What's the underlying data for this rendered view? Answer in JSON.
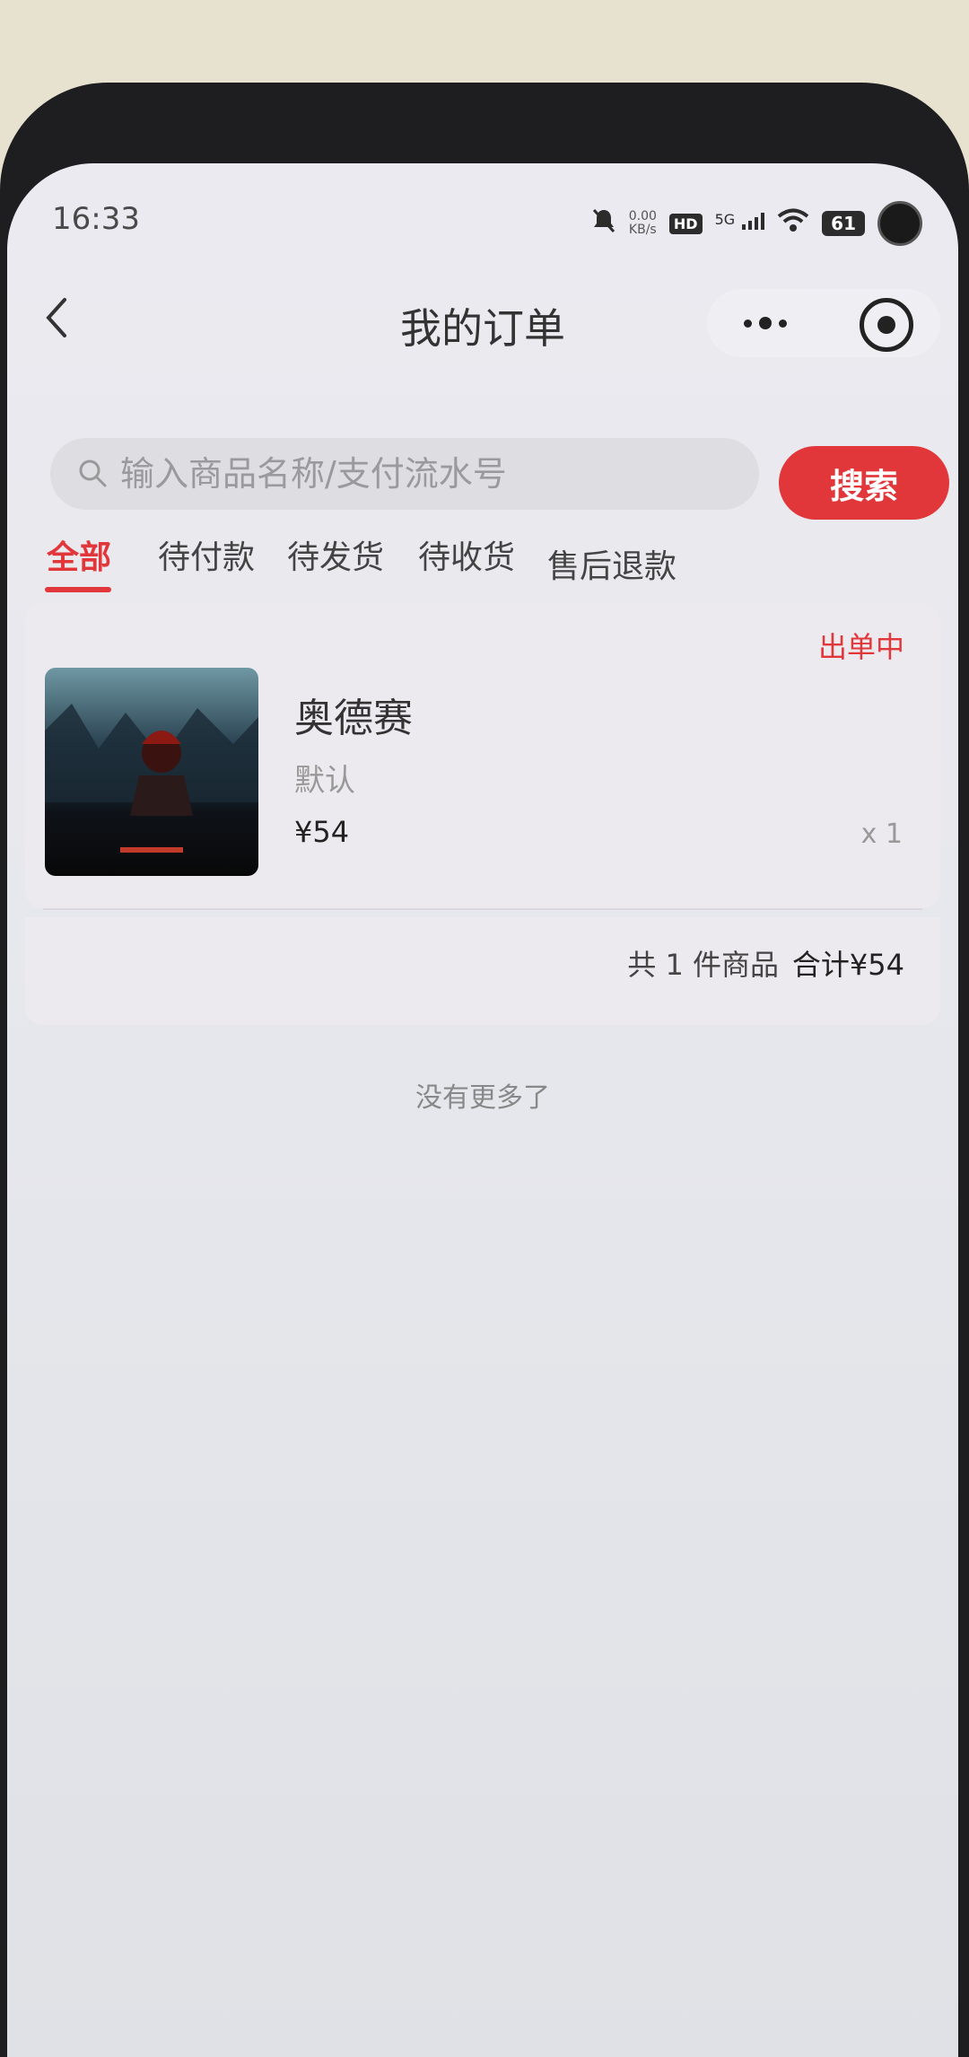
{
  "status_bar": {
    "time": "16:33",
    "net_speed_value": "0.00",
    "net_speed_unit": "KB/s",
    "hd_badge": "HD",
    "signal_label": "5G",
    "battery": "61"
  },
  "nav": {
    "title": "我的订单"
  },
  "search": {
    "placeholder": "输入商品名称/支付流水号",
    "button_label": "搜索"
  },
  "tabs": [
    {
      "label": "全部",
      "active": true
    },
    {
      "label": "待付款",
      "active": false
    },
    {
      "label": "待发货",
      "active": false
    },
    {
      "label": "待收货",
      "active": false
    },
    {
      "label": "售后退款",
      "active": false
    }
  ],
  "order": {
    "status": "出单中",
    "product_name": "奥德赛",
    "product_spec": "默认",
    "product_price": "¥54",
    "product_qty": "x 1",
    "summary_count": "共 1 件商品",
    "summary_total": "合计¥54"
  },
  "footer": {
    "no_more": "没有更多了"
  },
  "colors": {
    "accent": "#e2373a",
    "text_primary": "#333333",
    "text_secondary": "#999999"
  }
}
